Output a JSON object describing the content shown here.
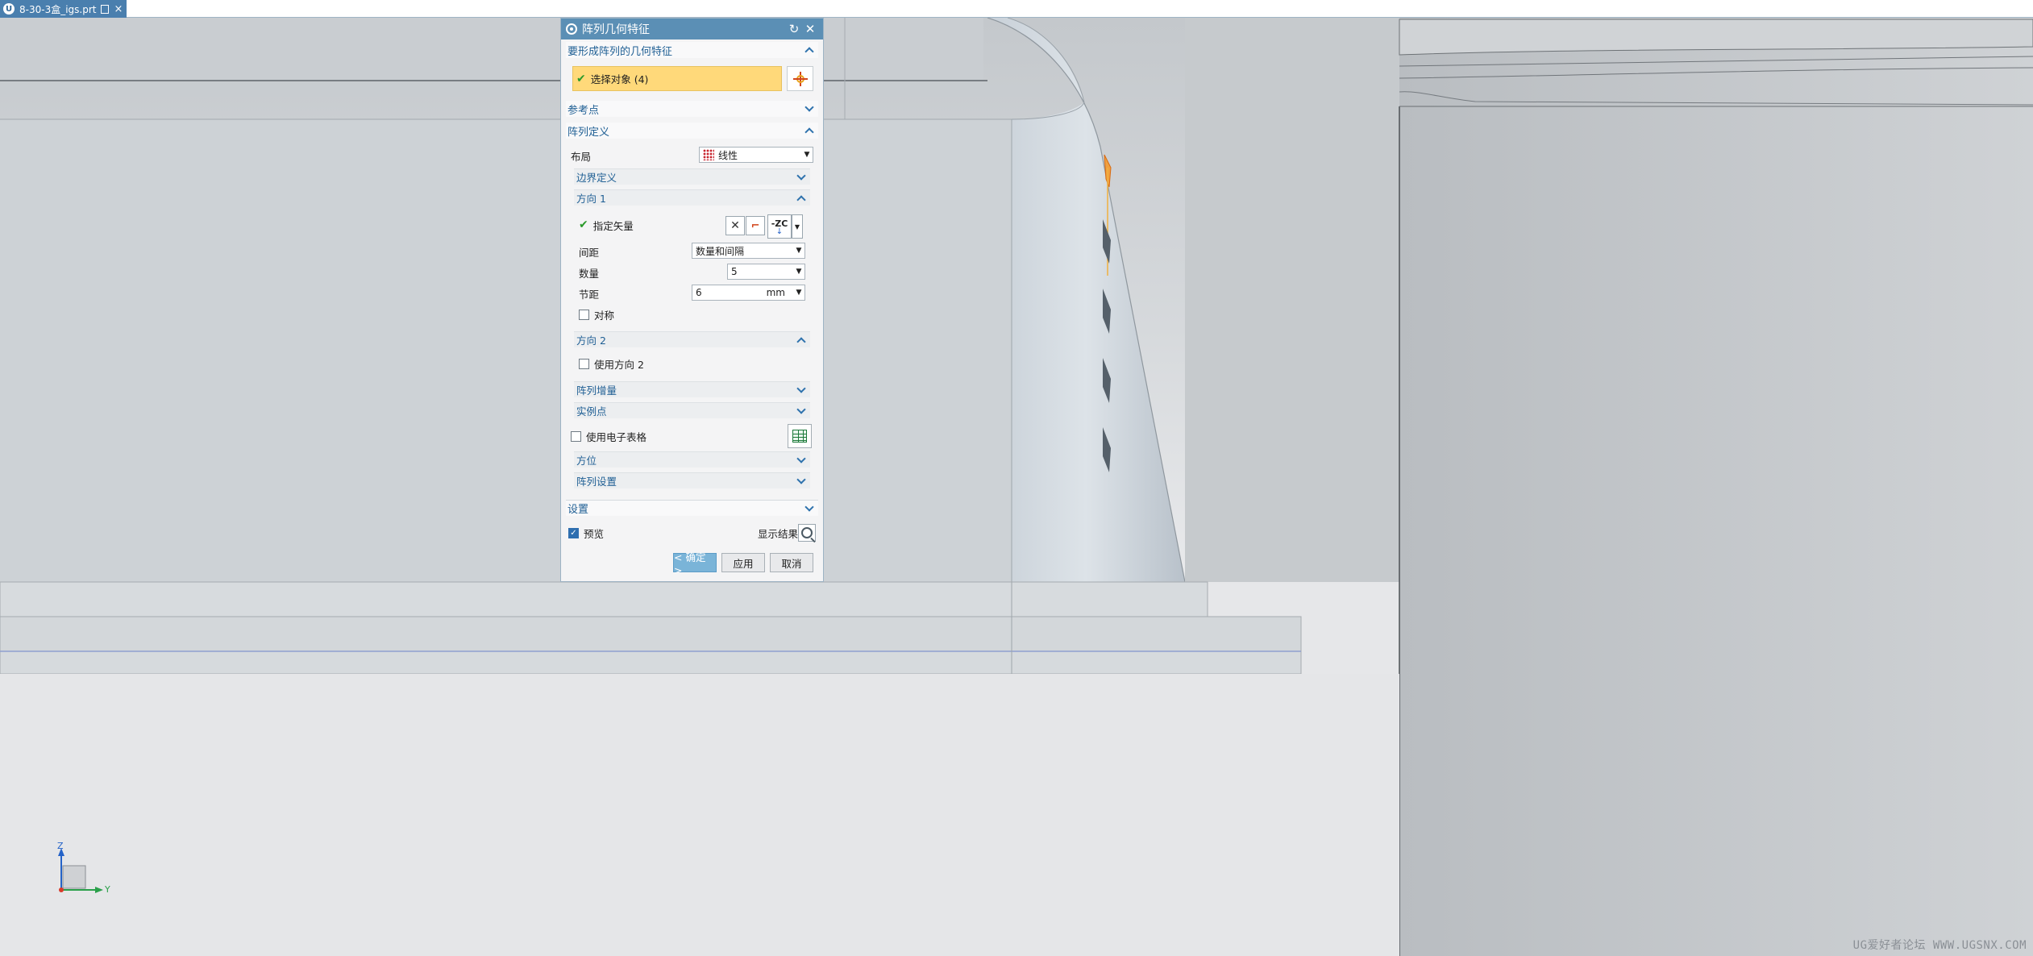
{
  "tab": {
    "app_icon_letter": "U",
    "file_name": "8-30-3盒_igs.prt",
    "close_glyph": "×"
  },
  "dialog": {
    "title": "阵列几何特征",
    "reset_glyph": "↻",
    "close_glyph": "✕",
    "sections": {
      "geometry_to_pattern": "要形成阵列的几何特征",
      "select_object": "选择对象 (4)",
      "reference_point": "参考点",
      "pattern_definition": "阵列定义",
      "settings": "设置"
    },
    "layout_label": "布局",
    "layout_value": "线性",
    "boundary_definition": "边界定义",
    "direction1": {
      "header": "方向 1",
      "specify_vector": "指定矢量",
      "vector_icon_text": "-ZC",
      "spacing_label": "间距",
      "spacing_value": "数量和间隔",
      "count_label": "数量",
      "count_value": "5",
      "pitch_label": "节距",
      "pitch_value": "6",
      "pitch_unit": "mm",
      "symmetric_label": "对称"
    },
    "direction2": {
      "header": "方向 2",
      "use_direction2": "使用方向 2"
    },
    "pattern_increment": "阵列增量",
    "instance_point": "实例点",
    "use_spreadsheet": "使用电子表格",
    "orientation": "方位",
    "pattern_settings": "阵列设置",
    "preview_label": "预览",
    "show_result": "显示结果",
    "buttons": {
      "ok": "< 确定 >",
      "apply": "应用",
      "cancel": "取消"
    }
  },
  "triad": {
    "z": "Z",
    "y": "Y"
  },
  "watermark": "UG爱好者论坛 WWW.UGSNX.COM",
  "colors": {
    "accent": "#5b8fb5",
    "selection": "#ffd97a",
    "viewport_bg": "#e6e7e9"
  }
}
